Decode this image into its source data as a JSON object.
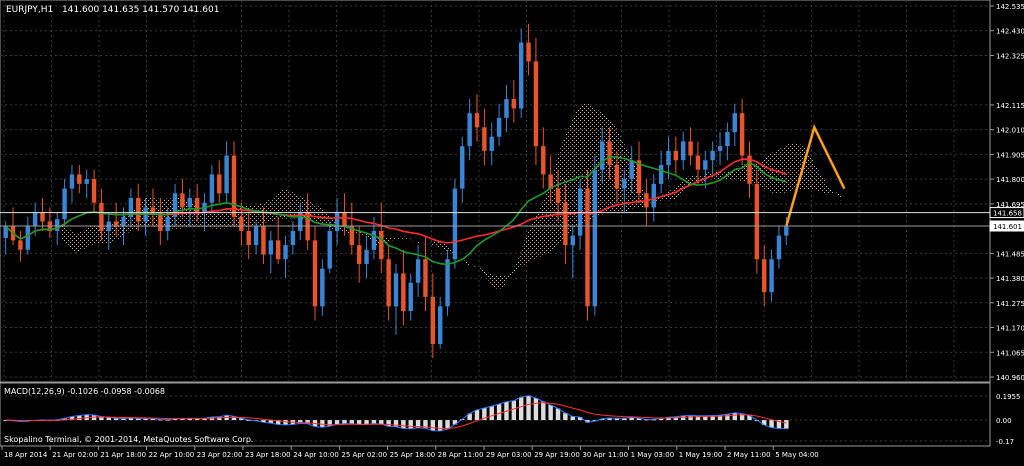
{
  "main_chart": {
    "header": {
      "symbol": "EURJPY,H1",
      "ohlc": "141.600 141.635 141.570 141.601"
    },
    "price_scale": [
      "142.535",
      "142.430",
      "142.325",
      "142.115",
      "142.010",
      "141.905",
      "141.800",
      "141.695",
      "141.485",
      "141.380",
      "141.275",
      "141.170",
      "141.065",
      "140.960"
    ],
    "price_tags": {
      "upper": "141.658",
      "lower": "141.601"
    },
    "colors": {
      "bull": "#3a86d6",
      "bear": "#e8552a",
      "ma_fast": "#ff2d2d",
      "ma_slow": "#1f9a2a",
      "cloud": "#f3c79a",
      "forecast": "#ff9f1c",
      "grid": "#3a3a3a"
    }
  },
  "macd": {
    "label": "MACD(12,26,9) -0.1026 -0.0958 -0.0068",
    "scale": [
      "0.1955",
      "0.00",
      "-0.17"
    ]
  },
  "footer": {
    "copyright": "Skopalino Terminal, © 2001-2014, MetaQuotes Software Corp."
  },
  "time_scale": [
    "18 Apr 2014",
    "21 Apr 02:00",
    "21 Apr 18:00",
    "22 Apr 10:00",
    "23 Apr 02:00",
    "23 Apr 18:00",
    "24 Apr 10:00",
    "25 Apr 02:00",
    "25 Apr 18:00",
    "28 Apr 11:00",
    "29 Apr 03:00",
    "29 Apr 19:00",
    "30 Apr 11:00",
    "1 May 03:00",
    "1 May 19:00",
    "2 May 11:00",
    "5 May 04:00"
  ],
  "chart_data": {
    "type": "candlestick",
    "symbol": "EURJPY",
    "timeframe": "H1",
    "last_ohlc": {
      "open": 141.6,
      "high": 141.635,
      "low": 141.57,
      "close": 141.601
    },
    "ylim": [
      140.96,
      142.535
    ],
    "price_levels": [
      141.658,
      141.601
    ],
    "macd": {
      "fast": 12,
      "slow": 26,
      "signal": 9,
      "main": -0.1026,
      "signal_value": -0.0958,
      "hist": -0.0068,
      "ylim": [
        -0.17,
        0.1955
      ]
    },
    "candles": [
      [
        141.55,
        141.62,
        141.48,
        141.6
      ],
      [
        141.6,
        141.68,
        141.52,
        141.54
      ],
      [
        141.54,
        141.58,
        141.45,
        141.5
      ],
      [
        141.5,
        141.64,
        141.48,
        141.6
      ],
      [
        141.6,
        141.7,
        141.56,
        141.66
      ],
      [
        141.66,
        141.72,
        141.58,
        141.62
      ],
      [
        141.62,
        141.68,
        141.55,
        141.58
      ],
      [
        141.58,
        141.66,
        141.52,
        141.63
      ],
      [
        141.63,
        141.8,
        141.6,
        141.76
      ],
      [
        141.76,
        141.86,
        141.7,
        141.82
      ],
      [
        141.82,
        141.86,
        141.74,
        141.78
      ],
      [
        141.78,
        141.84,
        141.72,
        141.8
      ],
      [
        141.8,
        141.84,
        141.66,
        141.7
      ],
      [
        141.7,
        141.76,
        141.54,
        141.58
      ],
      [
        141.58,
        141.66,
        141.5,
        141.62
      ],
      [
        141.62,
        141.7,
        141.56,
        141.6
      ],
      [
        141.6,
        141.68,
        141.52,
        141.64
      ],
      [
        141.64,
        141.76,
        141.6,
        141.72
      ],
      [
        141.72,
        141.78,
        141.58,
        141.62
      ],
      [
        141.62,
        141.72,
        141.56,
        141.68
      ],
      [
        141.68,
        141.76,
        141.6,
        141.66
      ],
      [
        141.66,
        141.72,
        141.52,
        141.58
      ],
      [
        141.58,
        141.68,
        141.54,
        141.64
      ],
      [
        141.64,
        141.78,
        141.6,
        141.74
      ],
      [
        141.74,
        141.8,
        141.64,
        141.68
      ],
      [
        141.68,
        141.76,
        141.6,
        141.72
      ],
      [
        141.72,
        141.78,
        141.62,
        141.66
      ],
      [
        141.66,
        141.74,
        141.58,
        141.7
      ],
      [
        141.7,
        141.86,
        141.66,
        141.82
      ],
      [
        141.82,
        141.88,
        141.7,
        141.74
      ],
      [
        141.74,
        141.96,
        141.7,
        141.9
      ],
      [
        141.9,
        141.96,
        141.6,
        141.64
      ],
      [
        141.64,
        141.7,
        141.52,
        141.58
      ],
      [
        141.58,
        141.66,
        141.46,
        141.52
      ],
      [
        141.52,
        141.62,
        141.48,
        141.6
      ],
      [
        141.6,
        141.68,
        141.44,
        141.48
      ],
      [
        141.48,
        141.58,
        141.4,
        141.54
      ],
      [
        141.54,
        141.64,
        141.44,
        141.46
      ],
      [
        141.46,
        141.56,
        141.38,
        141.52
      ],
      [
        141.52,
        141.62,
        141.48,
        141.58
      ],
      [
        141.58,
        141.7,
        141.54,
        141.66
      ],
      [
        141.66,
        141.74,
        141.5,
        141.54
      ],
      [
        141.54,
        141.6,
        141.2,
        141.26
      ],
      [
        141.26,
        141.46,
        141.22,
        141.42
      ],
      [
        141.42,
        141.62,
        141.4,
        141.58
      ],
      [
        141.58,
        141.72,
        141.52,
        141.66
      ],
      [
        141.66,
        141.74,
        141.56,
        141.6
      ],
      [
        141.6,
        141.7,
        141.48,
        141.52
      ],
      [
        141.52,
        141.6,
        141.36,
        141.44
      ],
      [
        141.44,
        141.56,
        141.38,
        141.5
      ],
      [
        141.5,
        141.64,
        141.46,
        141.58
      ],
      [
        141.58,
        141.7,
        141.4,
        141.46
      ],
      [
        141.46,
        141.52,
        141.2,
        141.26
      ],
      [
        141.26,
        141.44,
        141.14,
        141.4
      ],
      [
        141.4,
        141.5,
        141.18,
        141.24
      ],
      [
        141.24,
        141.4,
        141.2,
        141.36
      ],
      [
        141.36,
        141.52,
        141.3,
        141.46
      ],
      [
        141.46,
        141.56,
        141.24,
        141.3
      ],
      [
        141.3,
        141.4,
        141.04,
        141.1
      ],
      [
        141.1,
        141.3,
        141.08,
        141.26
      ],
      [
        141.26,
        141.5,
        141.22,
        141.46
      ],
      [
        141.46,
        141.8,
        141.42,
        141.76
      ],
      [
        141.76,
        141.98,
        141.7,
        141.94
      ],
      [
        141.94,
        142.14,
        141.88,
        142.08
      ],
      [
        142.08,
        142.16,
        141.96,
        142.02
      ],
      [
        142.02,
        142.1,
        141.86,
        141.92
      ],
      [
        141.92,
        142.04,
        141.86,
        141.98
      ],
      [
        141.98,
        142.12,
        141.94,
        142.06
      ],
      [
        142.06,
        142.2,
        142.0,
        142.14
      ],
      [
        142.14,
        142.22,
        142.04,
        142.1
      ],
      [
        142.1,
        142.44,
        142.06,
        142.38
      ],
      [
        142.38,
        142.46,
        142.24,
        142.3
      ],
      [
        142.3,
        142.4,
        141.86,
        141.94
      ],
      [
        141.94,
        142.02,
        141.76,
        141.82
      ],
      [
        141.82,
        141.9,
        141.7,
        141.76
      ],
      [
        141.76,
        141.84,
        141.62,
        141.7
      ],
      [
        141.7,
        141.78,
        141.44,
        141.52
      ],
      [
        141.52,
        141.6,
        141.38,
        141.56
      ],
      [
        141.56,
        141.8,
        141.5,
        141.76
      ],
      [
        141.76,
        141.84,
        141.2,
        141.26
      ],
      [
        141.26,
        141.9,
        141.22,
        141.84
      ],
      [
        141.84,
        142.02,
        141.78,
        141.96
      ],
      [
        141.96,
        142.02,
        141.8,
        141.86
      ],
      [
        141.86,
        141.92,
        141.7,
        141.76
      ],
      [
        141.76,
        141.84,
        141.66,
        141.8
      ],
      [
        141.8,
        141.94,
        141.74,
        141.88
      ],
      [
        141.88,
        141.96,
        141.7,
        141.74
      ],
      [
        141.74,
        141.8,
        141.6,
        141.68
      ],
      [
        141.68,
        141.82,
        141.62,
        141.78
      ],
      [
        141.78,
        141.92,
        141.74,
        141.86
      ],
      [
        141.86,
        141.98,
        141.8,
        141.92
      ],
      [
        141.92,
        141.98,
        141.82,
        141.88
      ],
      [
        141.88,
        142.0,
        141.84,
        141.96
      ],
      [
        141.96,
        142.02,
        141.86,
        141.9
      ],
      [
        141.9,
        141.96,
        141.78,
        141.84
      ],
      [
        141.84,
        141.92,
        141.76,
        141.88
      ],
      [
        141.88,
        141.96,
        141.82,
        141.92
      ],
      [
        141.92,
        142.0,
        141.86,
        141.94
      ],
      [
        141.94,
        142.04,
        141.88,
        142.0
      ],
      [
        142.0,
        142.12,
        141.94,
        142.08
      ],
      [
        142.08,
        142.14,
        141.86,
        141.9
      ],
      [
        141.9,
        141.96,
        141.72,
        141.78
      ],
      [
        141.78,
        141.84,
        141.4,
        141.46
      ],
      [
        141.46,
        141.52,
        141.26,
        141.32
      ],
      [
        141.32,
        141.5,
        141.28,
        141.46
      ],
      [
        141.46,
        141.6,
        141.42,
        141.56
      ],
      [
        141.56,
        141.64,
        141.52,
        141.6
      ]
    ]
  }
}
